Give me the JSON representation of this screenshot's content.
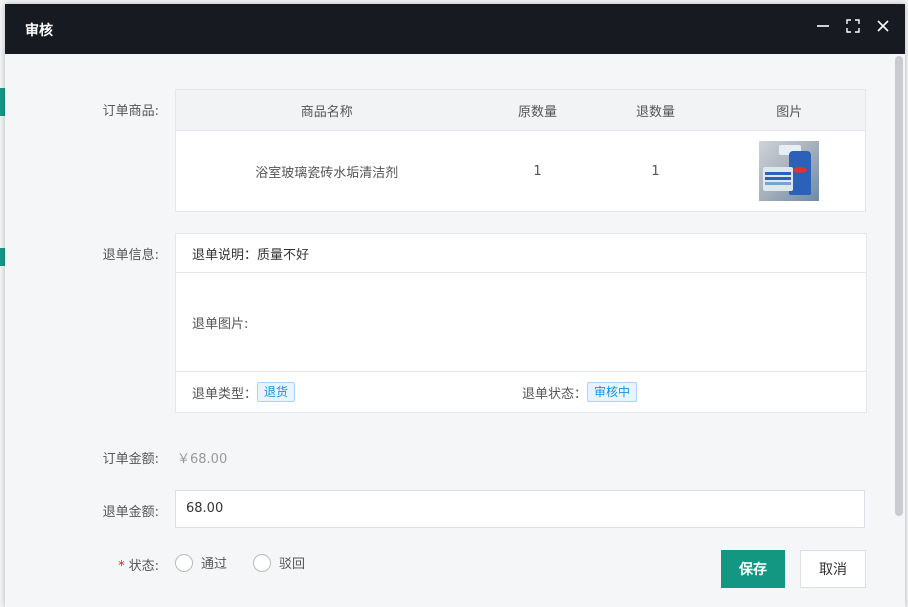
{
  "dialog": {
    "title": "审核"
  },
  "order_goods": {
    "label": "订单商品:",
    "columns": [
      "商品名称",
      "原数量",
      "退数量",
      "图片"
    ],
    "rows": [
      {
        "name": "浴室玻璃瓷砖水垢清洁剂",
        "original_qty": "1",
        "refund_qty": "1",
        "image": "product-thumbnail"
      }
    ]
  },
  "refund_info": {
    "label": "退单信息:",
    "description_label": "退单说明：",
    "description_value": "质量不好",
    "images_label": "退单图片:",
    "type_label": "退单类型：",
    "type_value": "退货",
    "status_label": "退单状态：",
    "status_value": "审核中"
  },
  "order_amount": {
    "label": "订单金额:",
    "value": "￥68.00"
  },
  "refund_amount": {
    "label": "退单金额:",
    "value": "68.00"
  },
  "status": {
    "required_mark": "*",
    "label": "状态:",
    "options": [
      "通过",
      "驳回"
    ]
  },
  "buttons": {
    "save": "保存",
    "cancel": "取消"
  },
  "colors": {
    "primary": "#139682",
    "titlebar": "#181a22",
    "tag_blue": "#1a8fe0"
  }
}
